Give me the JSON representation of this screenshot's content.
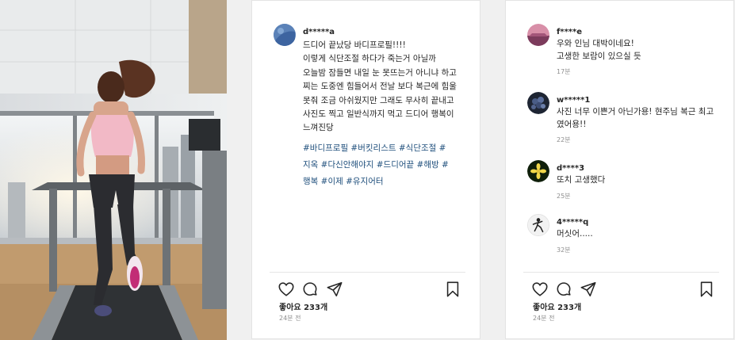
{
  "photo": {
    "icon": "treadmill-photo"
  },
  "post": {
    "username": "d*****a",
    "caption": "드디어 끝났당 바디프로필!!!!\n이렇게 식단조절 하다가 죽는거 아닐까\n오늘밤 잠들면 내일 눈 못뜨는거 아니냐 하고\n찌는 도중엔 힘들어서 전날 보다 복근에 힘울\n못줘 조금 아쉬웠지만 그래도 무사히 끝내고\n사진도 찍고 일반식까지 먹고 드디어 행복이\n느껴진당",
    "hashtags": "#바디프로필 #버킷리스트 #식단조절 #\n지옥 #다신안해야지 #드디어끝 #해방 #\n행복 #이제 #유지어터",
    "likes": "좋아요 233개",
    "time": "24분 전"
  },
  "comments": [
    {
      "username": "f****e",
      "text": "우와 인님 대박이네요!\n고생한 보람이 있으실 듯",
      "time": "17분",
      "avatar_color": "#b56a8e"
    },
    {
      "username": "w*****1",
      "text": "사진 너무 이쁜거 아닌가용! 현주님 복근 최고\n였어용!!",
      "time": "22분",
      "avatar_color": "#2e3b55"
    },
    {
      "username": "d****3",
      "text": "또치 고생했다",
      "time": "25분",
      "avatar_color": "#1d3a12"
    },
    {
      "username": "4*****q",
      "text": "머싯어.....",
      "time": "32분",
      "avatar_color": "#e8e8e8"
    }
  ],
  "right_footer": {
    "likes": "좋아요 233개",
    "time": "24분 전"
  },
  "icons": {
    "like": "heart-icon",
    "comment": "comment-icon",
    "share": "share-icon",
    "save": "bookmark-icon"
  },
  "colors": {
    "hashtag": "#1f4f7c",
    "muted": "#8e8e8e",
    "text": "#262626"
  }
}
